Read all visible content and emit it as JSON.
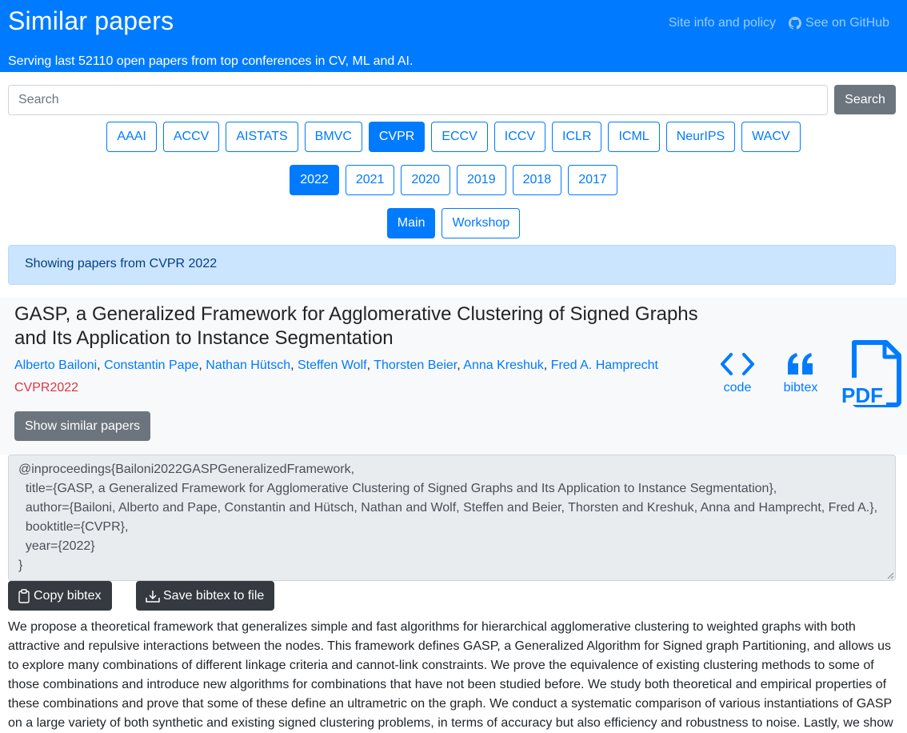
{
  "header": {
    "title": "Similar papers",
    "subtitle": "Serving last 52110 open papers from top conferences in CV, ML and AI.",
    "nav": {
      "site_info": "Site info and policy",
      "github": "See on GitHub"
    }
  },
  "search": {
    "placeholder": "Search",
    "button_label": "Search"
  },
  "conferences": [
    {
      "label": "AAAI",
      "active": false
    },
    {
      "label": "ACCV",
      "active": false
    },
    {
      "label": "AISTATS",
      "active": false
    },
    {
      "label": "BMVC",
      "active": false
    },
    {
      "label": "CVPR",
      "active": true
    },
    {
      "label": "ECCV",
      "active": false
    },
    {
      "label": "ICCV",
      "active": false
    },
    {
      "label": "ICLR",
      "active": false
    },
    {
      "label": "ICML",
      "active": false
    },
    {
      "label": "NeurIPS",
      "active": false
    },
    {
      "label": "WACV",
      "active": false
    }
  ],
  "years": [
    {
      "label": "2022",
      "active": true
    },
    {
      "label": "2021",
      "active": false
    },
    {
      "label": "2020",
      "active": false
    },
    {
      "label": "2019",
      "active": false
    },
    {
      "label": "2018",
      "active": false
    },
    {
      "label": "2017",
      "active": false
    }
  ],
  "tracks": [
    {
      "label": "Main",
      "active": true
    },
    {
      "label": "Workshop",
      "active": false
    }
  ],
  "alert": "Showing papers from CVPR 2022",
  "paper": {
    "title": "GASP, a Generalized Framework for Agglomerative Clustering of Signed Graphs and Its Application to Instance Segmentation",
    "authors": [
      "Alberto Bailoni",
      "Constantin Pape",
      "Nathan Hütsch",
      "Steffen Wolf",
      "Thorsten Beier",
      "Anna Kreshuk",
      "Fred A. Hamprecht"
    ],
    "venue": "CVPR2022",
    "similar_button": "Show similar papers",
    "code_label": "code",
    "bibtex_label": "bibtex",
    "pdf_label": "PDF"
  },
  "bibtex": "@inproceedings{Bailoni2022GASPGeneralizedFramework,\n  title={GASP, a Generalized Framework for Agglomerative Clustering of Signed Graphs and Its Application to Instance Segmentation},\n  author={Bailoni, Alberto and Pape, Constantin and Hütsch, Nathan and Wolf, Steffen and Beier, Thorsten and Kreshuk, Anna and Hamprecht, Fred A.},\n  booktitle={CVPR},\n  year={2022}\n}",
  "actions": {
    "copy_bibtex": "Copy bibtex",
    "save_bibtex": "Save bibtex to file"
  },
  "abstract": "We propose a theoretical framework that generalizes simple and fast algorithms for hierarchical agglomerative clustering to weighted graphs with both attractive and repulsive interactions between the nodes. This framework defines GASP, a Generalized Algorithm for Signed graph Partitioning, and allows us to explore many combinations of different linkage criteria and cannot-link constraints. We prove the equivalence of existing clustering methods to some of those combinations and introduce new algorithms for combinations that have not been studied before. We study both theoretical and empirical properties of these combinations and prove that some of these define an ultrametric on the graph. We conduct a systematic comparison of various instantiations of GASP on a large variety of both synthetic and existing signed clustering problems, in terms of accuracy but also efficiency and robustness to noise. Lastly, we show",
  "colors": {
    "primary": "#007bff",
    "secondary": "#6c757d",
    "dark": "#343a40",
    "danger": "#dc3545",
    "alert_bg": "#cce5ff"
  }
}
